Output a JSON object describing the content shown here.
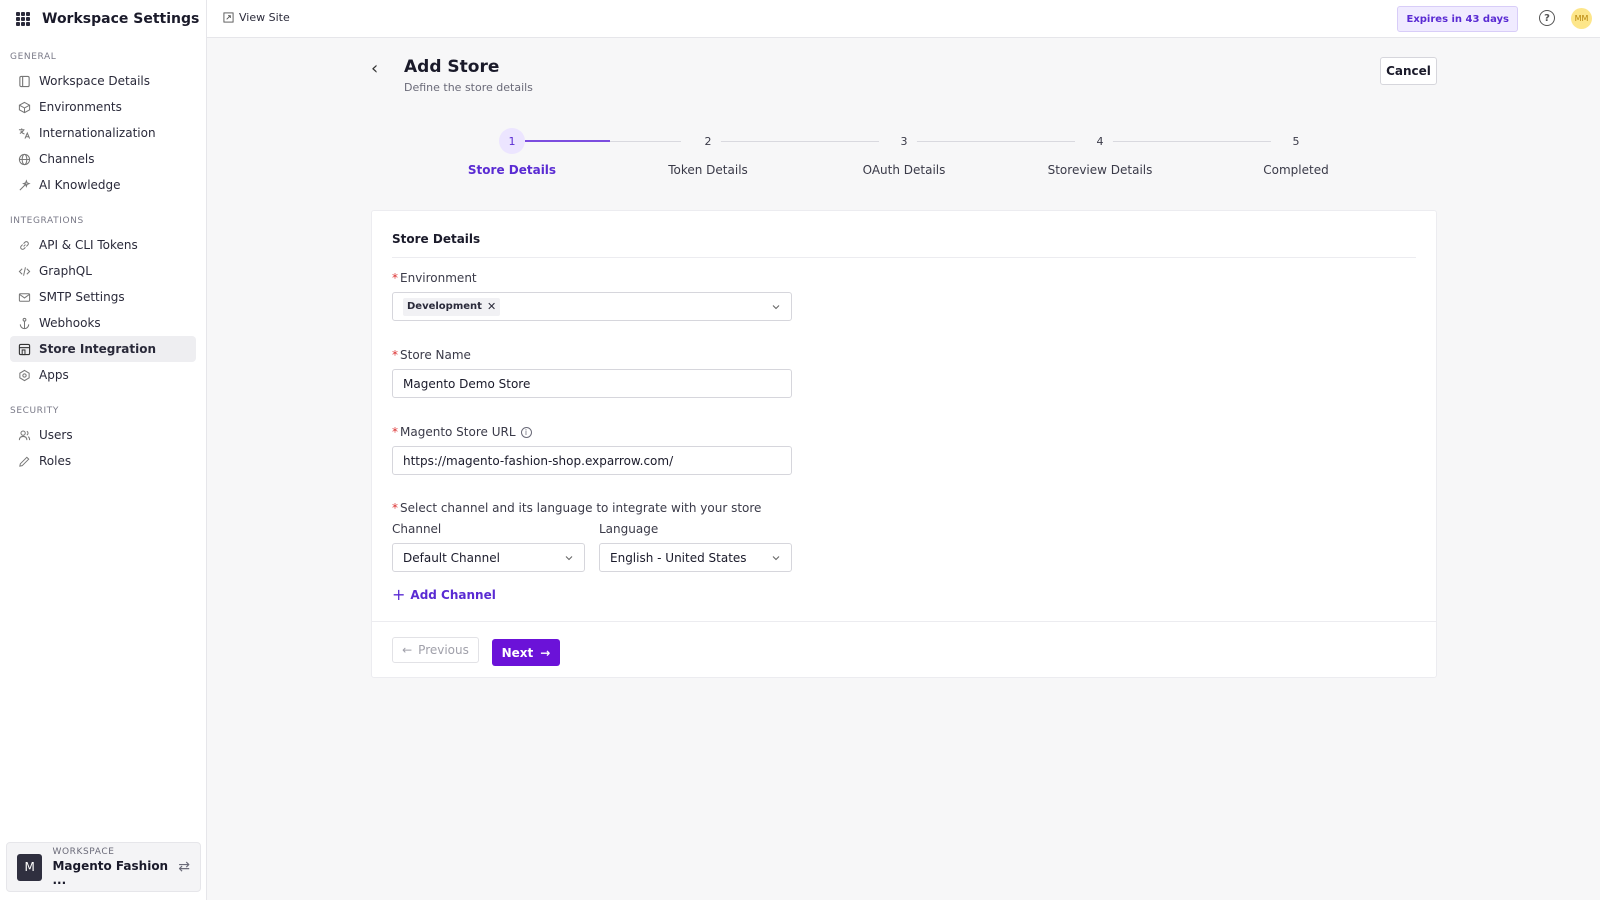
{
  "sidebar": {
    "title": "Workspace Settings",
    "sections": {
      "general": "GENERAL",
      "integrations": "INTEGRATIONS",
      "security": "SECURITY"
    },
    "items": {
      "workspace_details": "Workspace Details",
      "environments": "Environments",
      "internationalization": "Internationalization",
      "channels": "Channels",
      "ai_knowledge": "AI Knowledge",
      "api_tokens": "API & CLI Tokens",
      "graphql": "GraphQL",
      "smtp": "SMTP Settings",
      "webhooks": "Webhooks",
      "store_integration": "Store Integration",
      "apps": "Apps",
      "users": "Users",
      "roles": "Roles"
    },
    "active_item": "Store Integration",
    "workspace": {
      "label": "WORKSPACE",
      "name": "Magento Fashion ...",
      "avatar": "M"
    }
  },
  "topbar": {
    "view_site": "View Site",
    "expires": "Expires in 43 days",
    "help": "?",
    "user_initials": "MM"
  },
  "page": {
    "title": "Add Store",
    "subtitle": "Define the store details",
    "cancel": "Cancel"
  },
  "stepper": {
    "steps": [
      {
        "num": "1",
        "label": "Store Details"
      },
      {
        "num": "2",
        "label": "Token Details"
      },
      {
        "num": "3",
        "label": "OAuth Details"
      },
      {
        "num": "4",
        "label": "Storeview Details"
      },
      {
        "num": "5",
        "label": "Completed"
      }
    ],
    "current_step": 1
  },
  "form": {
    "section_title": "Store Details",
    "environment": {
      "label": "Environment",
      "chip": "Development"
    },
    "store_name": {
      "label": "Store Name",
      "value": "Magento Demo Store"
    },
    "store_url": {
      "label": "Magento Store URL",
      "value": "https://magento-fashion-shop.exparrow.com/"
    },
    "channel_select": {
      "label": "Select channel and its language to integrate with your store",
      "channel_label": "Channel",
      "channel_value": "Default Channel",
      "language_label": "Language",
      "language_value": "English - United States"
    },
    "add_channel": "Add Channel",
    "previous": "Previous",
    "next": "Next"
  },
  "colors": {
    "accent": "#6b12d8",
    "accent_text": "#5a2bd3",
    "required": "#dd3333"
  }
}
